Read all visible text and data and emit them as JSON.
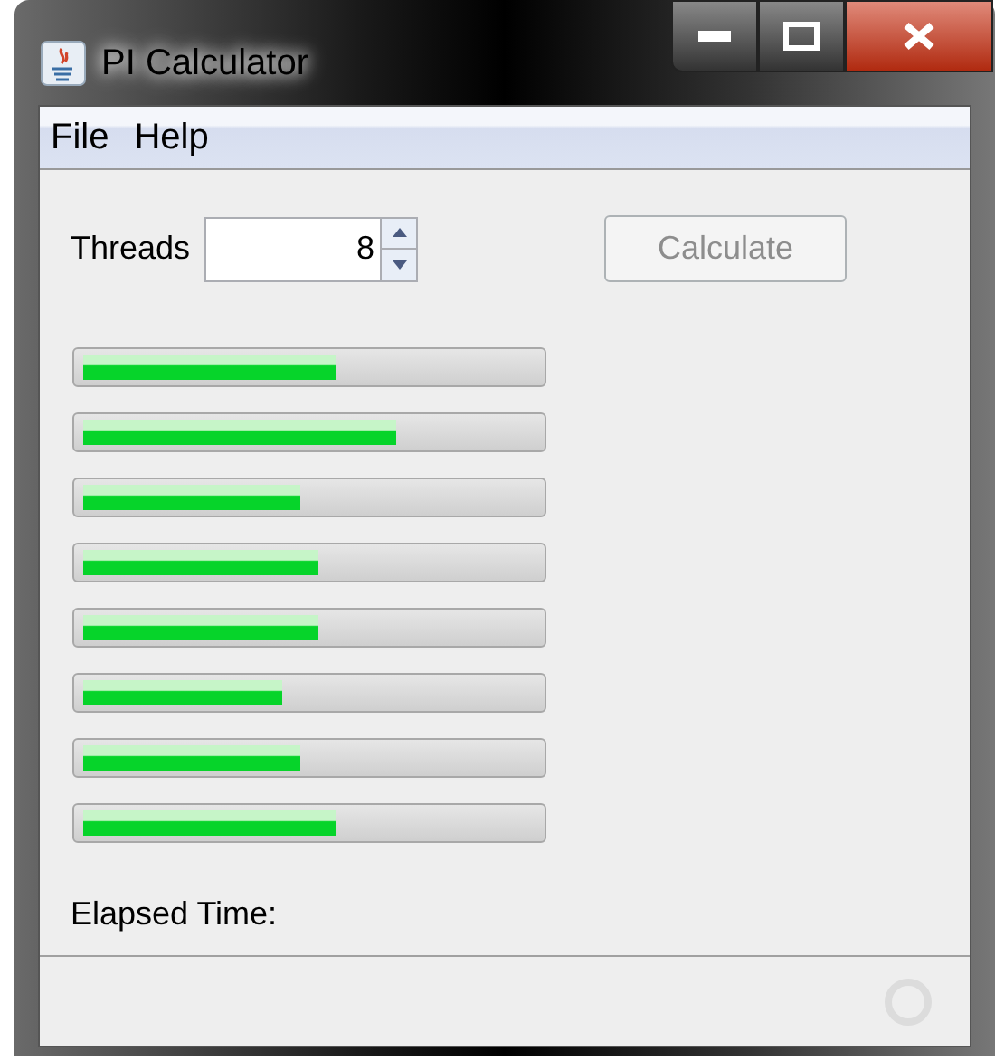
{
  "window": {
    "title": "PI Calculator"
  },
  "menu": [
    "File",
    "Help"
  ],
  "threads": {
    "label": "Threads",
    "value": "8"
  },
  "calculate_button": {
    "label": "Calculate",
    "disabled": true
  },
  "progress_bars": [
    {
      "level": 0.56
    },
    {
      "level": 0.69
    },
    {
      "level": 0.48
    },
    {
      "level": 0.52
    },
    {
      "level": 0.52
    },
    {
      "level": 0.44
    },
    {
      "level": 0.48
    },
    {
      "level": 0.56
    }
  ],
  "elapsed_label": "Elapsed Time:",
  "status_bar": {
    "busy": false
  }
}
